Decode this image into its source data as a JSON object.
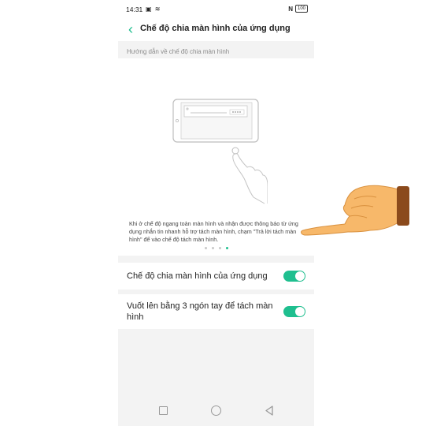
{
  "status": {
    "time": "14:31",
    "left_icons": "▣ ≋",
    "nfc": "N",
    "battery": "100"
  },
  "header": {
    "title": "Chế độ chia màn hình của ứng dụng"
  },
  "guide": {
    "caption": "Hướng dẫn về chế độ chia màn hình",
    "text": "Khi ở chế độ ngang toàn màn hình và nhận được thông báo từ ứng dụng nhắn tin nhanh hỗ trợ tách màn hình, chạm \"Trả lời tách màn hình\" để vào chế độ tách màn hình.",
    "page_count": 4,
    "active_page": 4
  },
  "settings": [
    {
      "label": "Chế độ chia màn hình của ứng dụng",
      "enabled": true
    },
    {
      "label": "Vuốt lên bằng 3 ngón tay để tách màn hình",
      "enabled": true
    }
  ],
  "colors": {
    "accent": "#1fbf8f",
    "hand_skin": "#f7b86a",
    "cuff": "#8b4a1c"
  }
}
